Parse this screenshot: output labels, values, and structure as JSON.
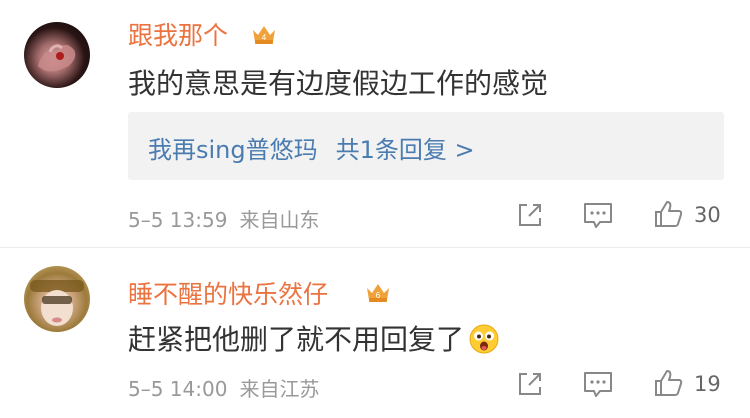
{
  "comments": [
    {
      "username": "跟我那个",
      "badge_level": "4",
      "text": "我的意思是有边度假边工作的感觉",
      "reply_preview": {
        "reply_user": "我再sing普悠玛",
        "reply_count_text": "共1条回复 >"
      },
      "date": "5–5 13:59",
      "location": "来自山东",
      "likes": "30"
    },
    {
      "username": "睡不醒的快乐然仔",
      "badge_level": "6",
      "text": "赶紧把他删了就不用回复了",
      "emoji": "grinning-face-emoji",
      "date": "5–5 14:00",
      "location": "来自江苏",
      "likes": "19"
    }
  ],
  "colors": {
    "username": "#eb7340",
    "body_text": "#333333",
    "reply_link": "#4a7cb0",
    "meta": "#999999",
    "reply_box_bg": "#f2f2f2"
  },
  "icons": [
    "crown-badge-icon",
    "share-icon",
    "comment-icon",
    "like-icon"
  ]
}
